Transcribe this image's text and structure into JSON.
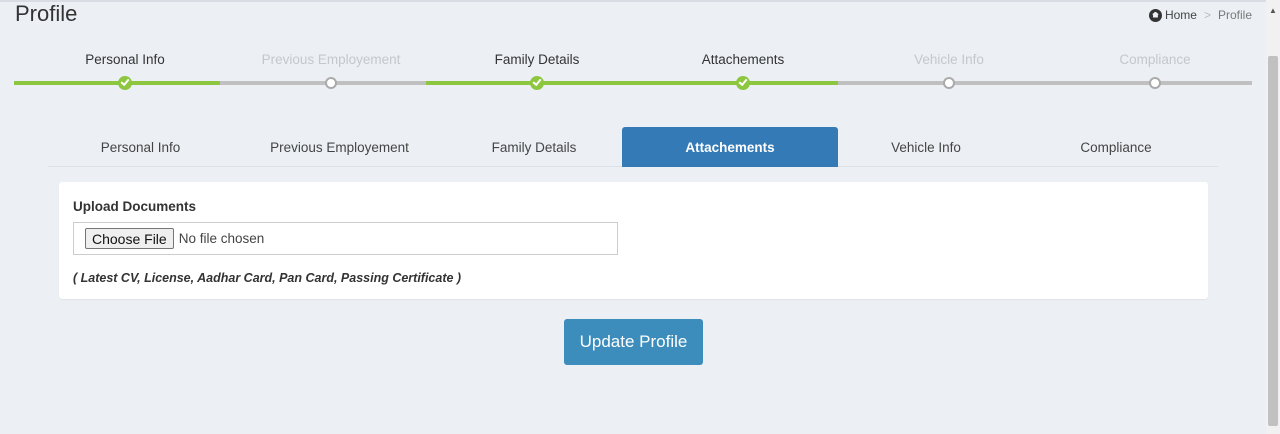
{
  "page": {
    "title": "Profile"
  },
  "breadcrumb": {
    "home": "Home",
    "separator": ">",
    "current": "Profile"
  },
  "wizard": {
    "steps": [
      {
        "label": "Personal Info",
        "status": "done"
      },
      {
        "label": "Previous Employement",
        "status": "todo"
      },
      {
        "label": "Family Details",
        "status": "done"
      },
      {
        "label": "Attachements",
        "status": "done"
      },
      {
        "label": "Vehicle Info",
        "status": "todo"
      },
      {
        "label": "Compliance",
        "status": "todo"
      }
    ],
    "colors": {
      "done": "#8dc63f",
      "todo": "#c0c0c0"
    }
  },
  "tabs": {
    "items": [
      {
        "label": "Personal Info"
      },
      {
        "label": "Previous Employement"
      },
      {
        "label": "Family Details"
      },
      {
        "label": "Attachements",
        "active": true
      },
      {
        "label": "Vehicle Info"
      },
      {
        "label": "Compliance"
      }
    ],
    "active_color": "#337ab7"
  },
  "upload": {
    "label": "Upload Documents",
    "button": "Choose File",
    "status": "No file chosen",
    "hint": "( Latest CV, License, Aadhar Card, Pan Card, Passing Certificate )"
  },
  "actions": {
    "update_label": "Update Profile",
    "update_color": "#3c8dbc"
  },
  "icons": {
    "home": "home-icon",
    "step_done": "check-circle-icon",
    "step_todo": "empty-circle-icon"
  }
}
